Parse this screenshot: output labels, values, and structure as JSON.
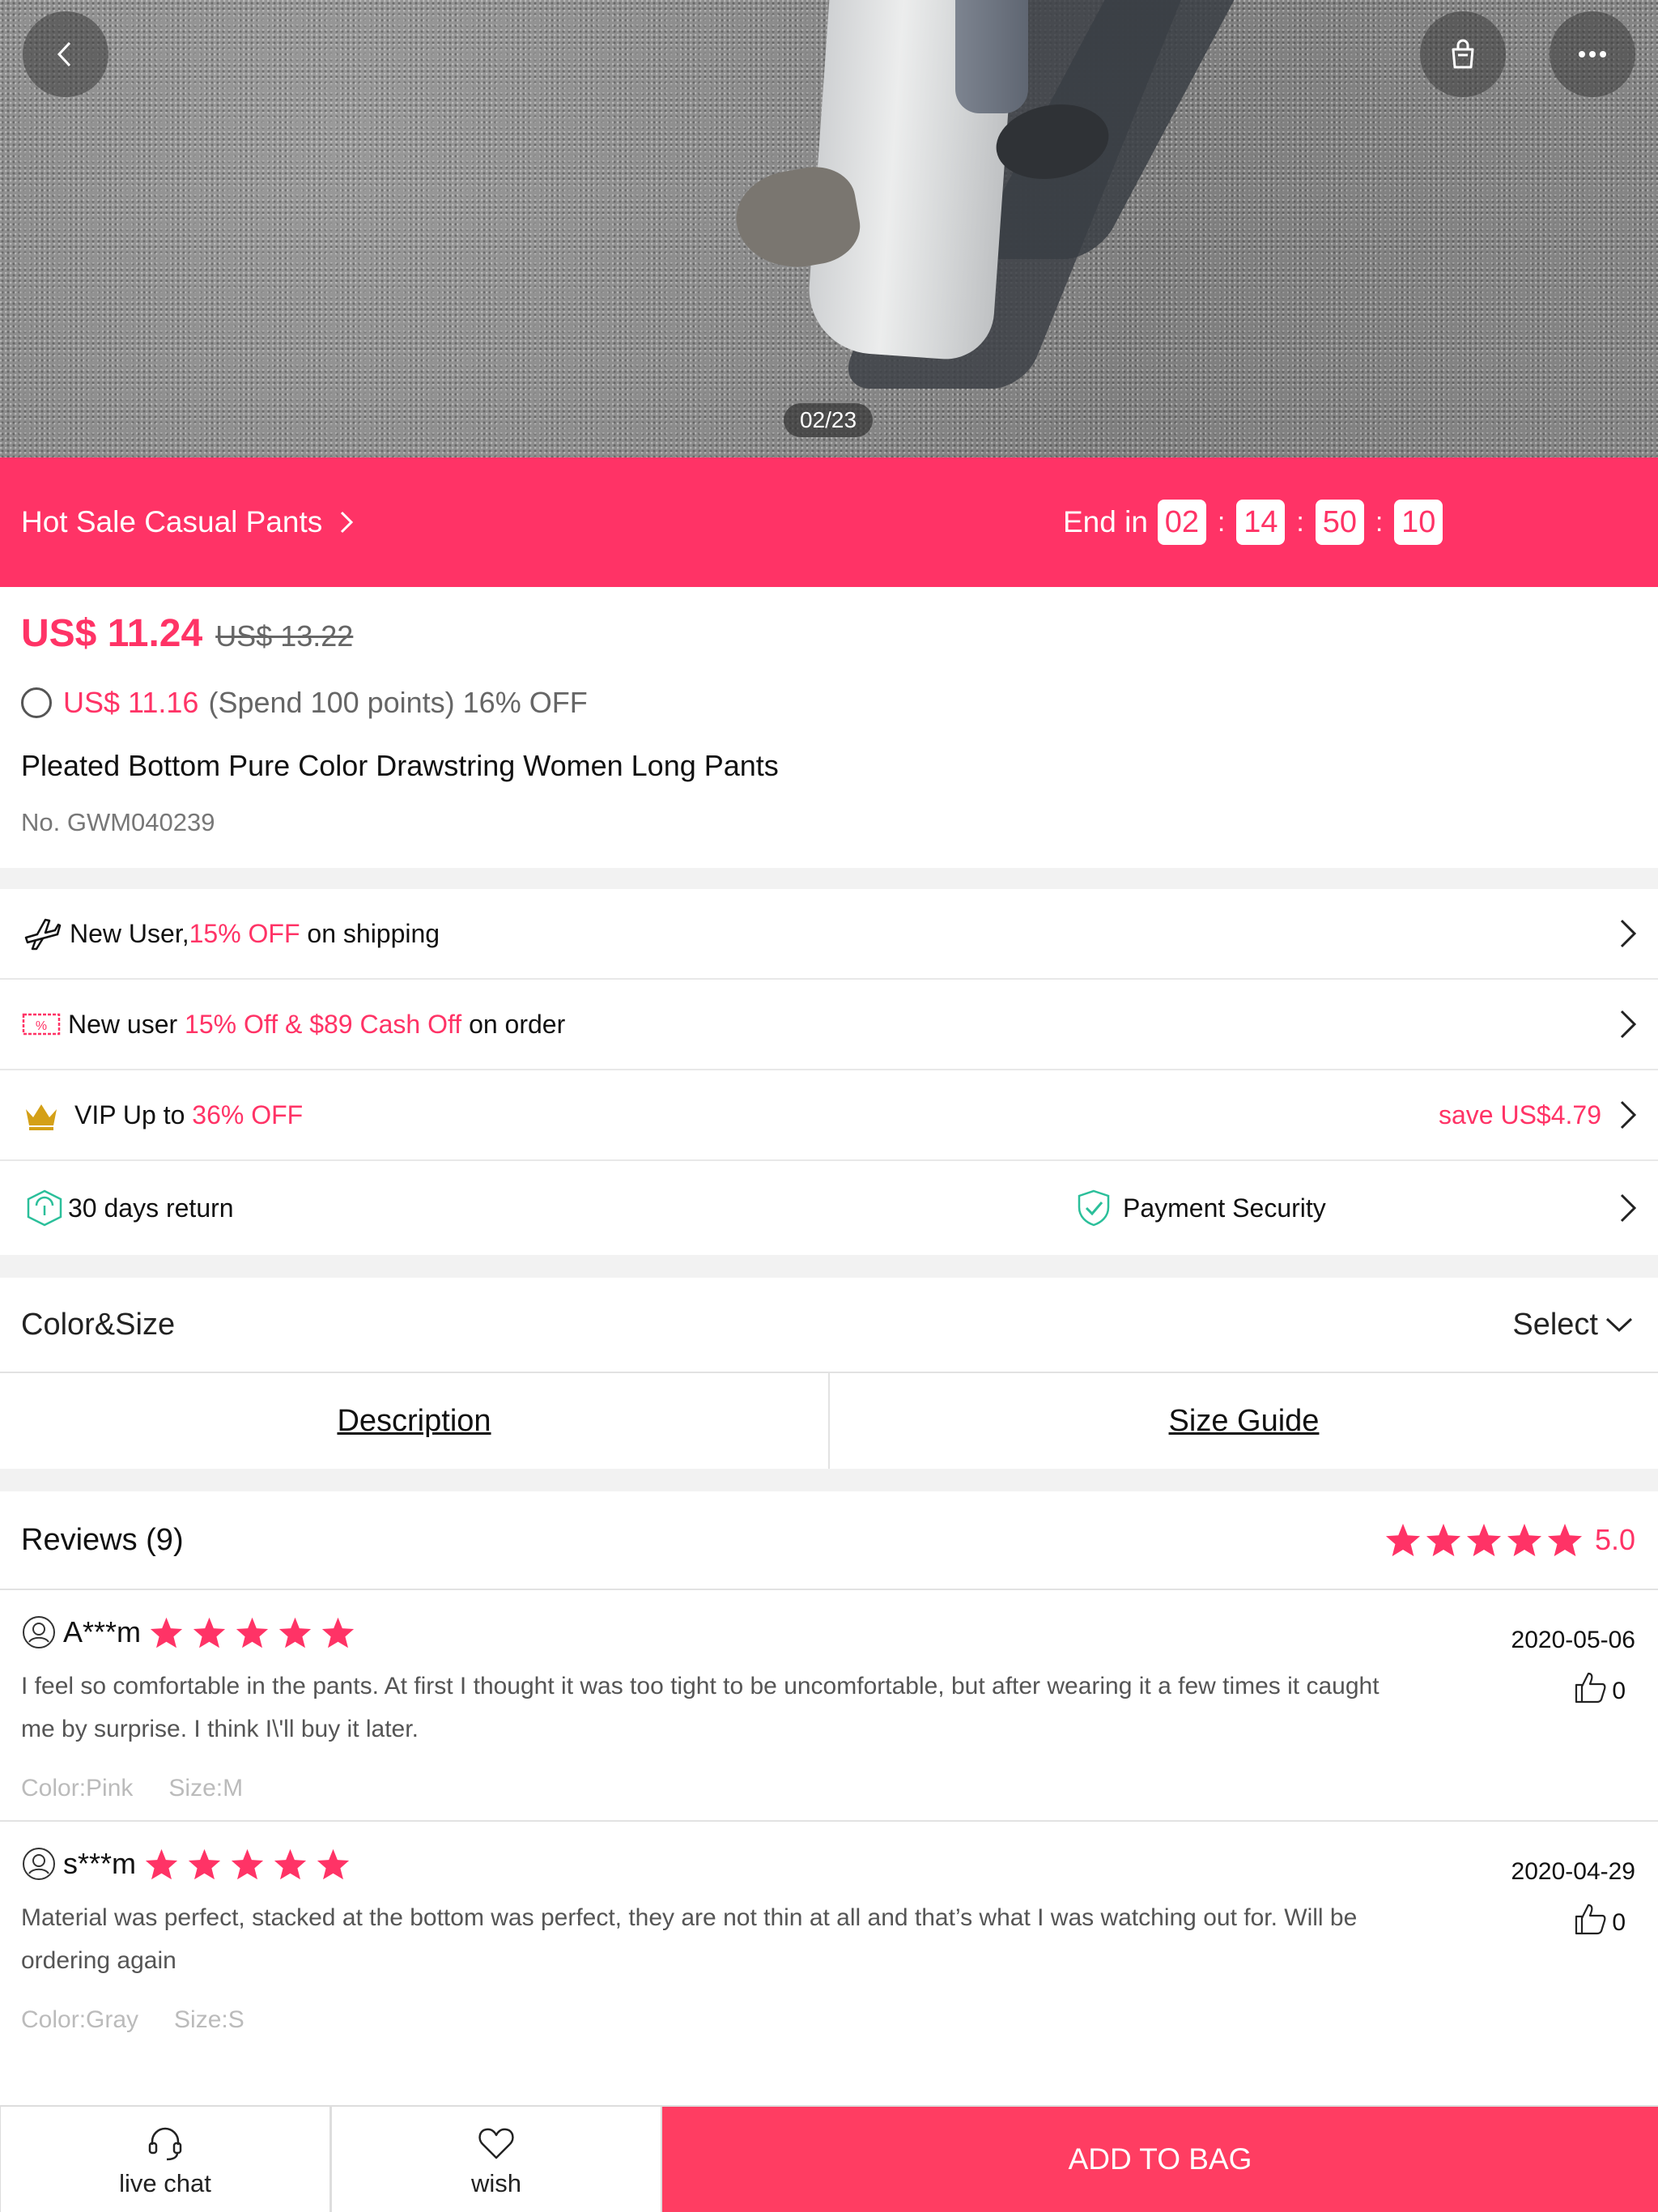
{
  "gallery": {
    "counter": "02/23",
    "image_alt": "Model wearing light gray pleated pants walking on asphalt"
  },
  "toolbar": {
    "back_icon": "chevron-left-icon",
    "bag_icon": "shopping-bag-icon",
    "more_icon": "more-dots-icon"
  },
  "sale_banner": {
    "title": "Hot Sale Casual Pants",
    "end_label": "End in",
    "timer": [
      "02",
      "14",
      "50",
      "10"
    ],
    "color": "#ff3366"
  },
  "price": {
    "current": "US$ 11.24",
    "original": "US$ 13.22",
    "points_price": "US$ 11.16",
    "points_text": "(Spend 100 points) 16% OFF"
  },
  "product": {
    "title": "Pleated Bottom Pure Color Drawstring Women Long Pants",
    "number": "No. GWM040239"
  },
  "promos": {
    "shipping": {
      "prefix": "New User,",
      "highlight": "15% OFF",
      "suffix": " on shipping",
      "icon": "airplane-icon"
    },
    "order": {
      "prefix": "New user ",
      "highlight": "15% Off & $89 Cash Off",
      "suffix": " on order",
      "icon": "coupon-icon"
    },
    "vip": {
      "prefix": "VIP Up to ",
      "highlight": "36% OFF",
      "save": "save US$4.79",
      "icon": "crown-icon"
    },
    "service": {
      "returns": "30 days return",
      "security": "Payment Security",
      "returns_icon": "return-box-icon",
      "security_icon": "shield-check-icon"
    }
  },
  "options": {
    "label": "Color&Size",
    "select": "Select"
  },
  "tabs": {
    "description": "Description",
    "size_guide": "Size Guide"
  },
  "reviews": {
    "header": "Reviews (9)",
    "score": "5.0",
    "items": [
      {
        "user": "A***m",
        "rating": 5,
        "date": "2020-05-06",
        "likes": "0",
        "text": "I feel so comfortable in the pants. At first I thought it was too tight to be uncomfortable, but after wearing it a few times it caught me by surprise. I think I\\'ll buy it later.",
        "color": "Color:Pink",
        "size": "Size:M"
      },
      {
        "user": "s***m",
        "rating": 5,
        "date": "2020-04-29",
        "likes": "0",
        "text": "Material was perfect, stacked at the bottom was perfect, they are not thin at all and that’s what I was watching out for. Will be ordering again",
        "color": "Color:Gray",
        "size": "Size:S"
      }
    ]
  },
  "bottom_bar": {
    "chat": "live chat",
    "wish": "wish",
    "add": "ADD TO BAG",
    "accent": "#ff3d62"
  }
}
